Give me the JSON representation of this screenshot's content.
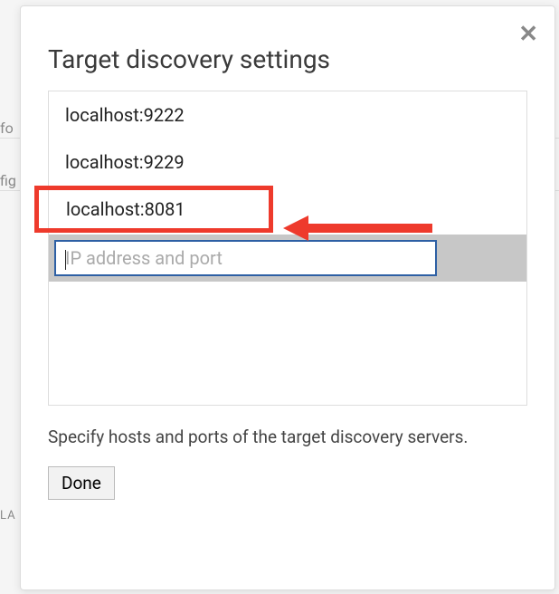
{
  "background": {
    "frag1": "fo",
    "frag2": "fig",
    "frag3": "LA"
  },
  "dialog": {
    "title": "Target discovery settings",
    "close_label": "✕",
    "items": [
      {
        "value": "localhost:9222",
        "highlighted": false
      },
      {
        "value": "localhost:9229",
        "highlighted": false
      },
      {
        "value": "localhost:8081",
        "highlighted": true
      }
    ],
    "input": {
      "placeholder": "IP address and port",
      "value": ""
    },
    "help_text": "Specify hosts and ports of the target discovery servers.",
    "done_label": "Done"
  },
  "annotation": {
    "highlight_color": "#ee3a2c"
  }
}
